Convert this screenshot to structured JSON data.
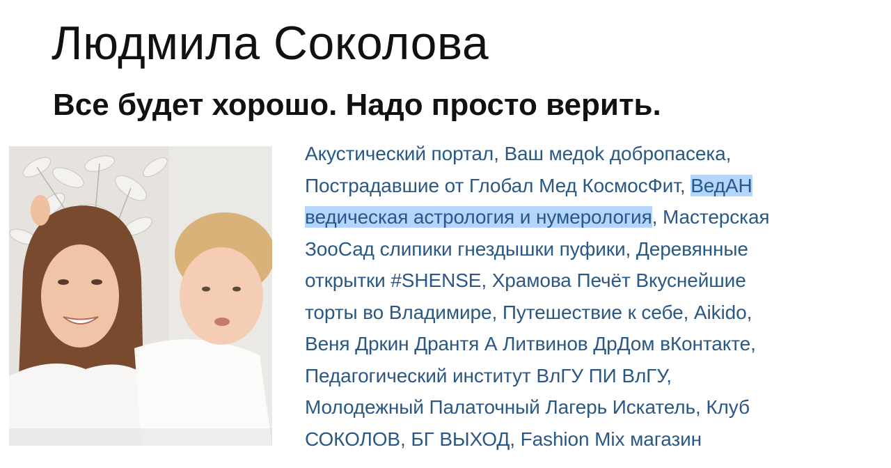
{
  "profile": {
    "name": "Людмила Соколова",
    "status": "Все будет хорошо. Надо просто верить."
  },
  "groups": [
    "Акустический портал",
    "Ваш медоk добропасека",
    "Пострадавшие от Глобал Мед КосмосФит",
    "ВедАН ведическая астрология и нумерология",
    "Мастерская ЗооСад слипики гнездышки пуфики",
    "Деревянные открытки #SHENSE",
    "Храмова Печёт Вкуснейшие торты во Владимире",
    "Путешествие к себе",
    "Aikido",
    "Веня Дркин Дрантя А Литвинов ДрДом вКонтакте",
    "Педагогический институт ВлГУ ПИ ВлГУ",
    "Молодежный Палаточный Лагерь Искатель",
    "Клуб СОКОЛОВ",
    "БГ ВЫХОД",
    "Fashion Mix магазин"
  ],
  "groups_fragments": {
    "ved_a": "ВедАН",
    "ved_b": "ведическая астрология и нумерология",
    "mast_a": "Мастерская",
    "mast_b": "ЗооСад слипики гнездышки пуфики",
    "der_a": "Деревянные",
    "der_b": "открытки #SHENSE",
    "hram_a": "Храмова Печёт Вкуснейшие",
    "hram_b": "торты во Владимире",
    "klub_a": "Клуб",
    "klub_b": "СОКОЛОВ"
  },
  "separator": ", ",
  "colors": {
    "link": "#2a5885",
    "selection": "#b4d5fe",
    "text": "#111111"
  },
  "selected_group": "ВедАН ведическая астрология и нумерология"
}
